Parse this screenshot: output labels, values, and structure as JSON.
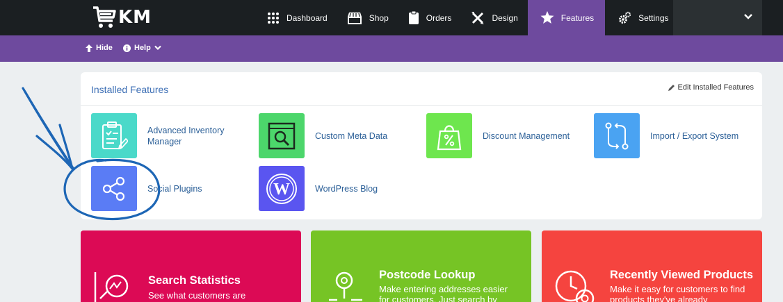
{
  "brand": {
    "logo_text": "KM"
  },
  "nav": {
    "items": [
      {
        "label": "Dashboard",
        "icon": "grid-icon"
      },
      {
        "label": "Shop",
        "icon": "store-icon"
      },
      {
        "label": "Orders",
        "icon": "clipboard-icon"
      },
      {
        "label": "Design",
        "icon": "design-tools-icon"
      },
      {
        "label": "Features",
        "icon": "star-icon",
        "active": true
      },
      {
        "label": "Settings",
        "icon": "gears-icon"
      }
    ]
  },
  "subbar": {
    "hide_label": "Hide",
    "help_label": "Help"
  },
  "installed": {
    "title": "Installed Features",
    "edit_label": "Edit Installed Features",
    "features": [
      {
        "label": "Advanced Inventory Manager",
        "color": "#4ad9c9",
        "icon": "inventory-clipboard-icon"
      },
      {
        "label": "Custom Meta Data",
        "color": "#4cd66b",
        "icon": "search-doc-icon"
      },
      {
        "label": "Discount Management",
        "color": "#6ee64e",
        "icon": "discount-bag-icon"
      },
      {
        "label": "Import / Export System",
        "color": "#4aa3f2",
        "icon": "import-export-icon"
      },
      {
        "label": "Social Plugins",
        "color": "#5a7cf5",
        "icon": "share-icon"
      },
      {
        "label": "WordPress Blog",
        "color": "#5a55f0",
        "icon": "wordpress-icon"
      }
    ]
  },
  "cards": [
    {
      "title": "Search Statistics",
      "desc": "See what customers are",
      "color": "#dc0a55",
      "icon": "search-stats-icon"
    },
    {
      "title": "Postcode Lookup",
      "desc": "Make entering addresses easier for customers. Just search by",
      "color": "#76c425",
      "icon": "map-pin-icon"
    },
    {
      "title": "Recently Viewed Products",
      "desc": "Make it easy for customers to find products they've already",
      "color": "#f5443f",
      "icon": "clock-eye-icon"
    }
  ],
  "colors": {
    "topbar": "#1b1f22",
    "accent": "#6e4a9e",
    "link": "#2c6098",
    "annotation": "#1d66b5"
  }
}
